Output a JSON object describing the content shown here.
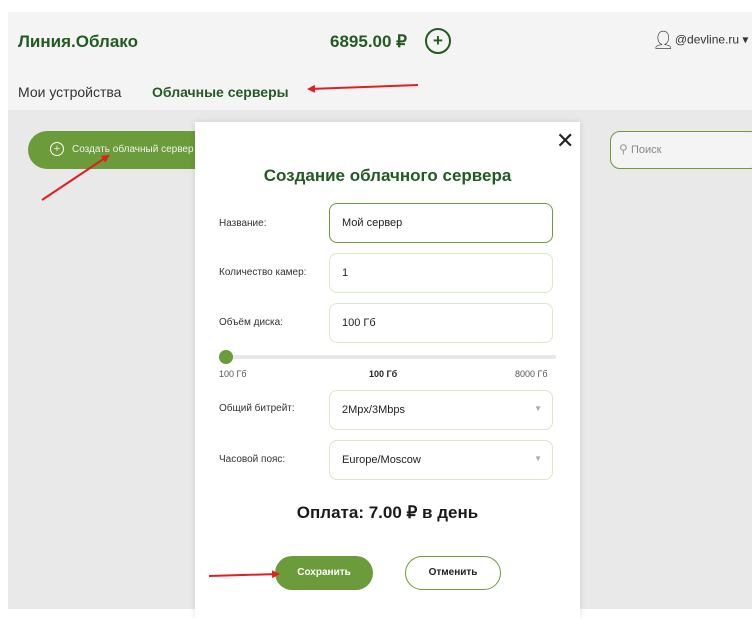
{
  "header": {
    "brand": "Линия.Облако",
    "balance": "6895.00 ₽",
    "add_balance_label": "+",
    "user": "@devline.ru",
    "user_icon": "user-icon",
    "user_dropdown_icon": "chevron-down-icon"
  },
  "nav": {
    "devices": "Мои устройства",
    "cloud_servers": "Облачные серверы",
    "active": "cloud_servers"
  },
  "toolbar": {
    "create_button": "Создать облачный сервер",
    "create_icon": "plus-circle-icon",
    "search_placeholder": "Поиск",
    "search_icon": "search-icon"
  },
  "modal": {
    "title": "Создание облачного сервера",
    "close_icon": "close-icon",
    "fields": {
      "name": {
        "label": "Название:",
        "value": "Мой сервер"
      },
      "cameras": {
        "label": "Количество камер:",
        "value": "1"
      },
      "disk": {
        "label": "Объём диска:",
        "value": "100 Гб"
      }
    },
    "slider": {
      "min": "100 Гб",
      "current": "100 Гб",
      "max": "8000 Гб",
      "fraction": 0
    },
    "bitrate": {
      "label": "Общий битрейт:",
      "value": "2Mpx/3Mbps"
    },
    "timezone": {
      "label": "Часовой пояс:",
      "value": "Europe/Moscow"
    },
    "payment": "Оплата: 7.00 ₽ в день",
    "save_button": "Сохранить",
    "cancel_button": "Отменить"
  },
  "colors": {
    "brand_green": "#225b22",
    "accent_green": "#6b9b3a",
    "annotation_red": "#e02020"
  }
}
